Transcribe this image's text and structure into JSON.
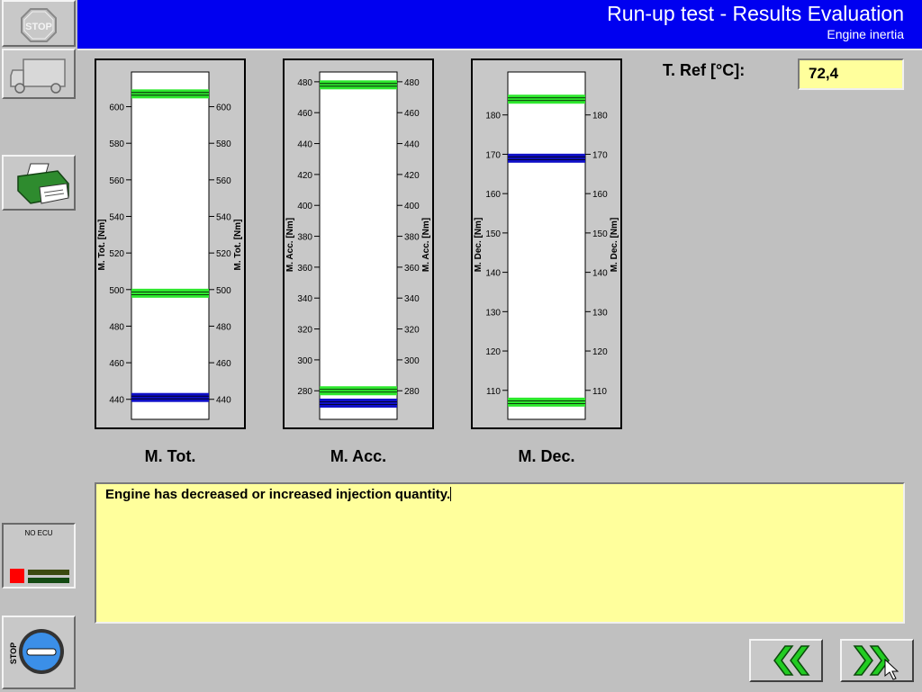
{
  "header": {
    "title": "Run-up test - Results Evaluation",
    "subtitle": "Engine inertia"
  },
  "sidebar": {
    "stop_button": {
      "label": "STOP",
      "icon": "stop-icon"
    },
    "vehicle_button": {
      "icon": "truck-icon"
    },
    "print_button": {
      "icon": "printer-icon"
    },
    "ecu_status": {
      "label": "NO ECU",
      "status_color": "#ff0000"
    },
    "stop_round_button": {
      "label": "STOP",
      "icon": "stop-round-icon"
    }
  },
  "t_ref": {
    "label": "T. Ref [°C]:",
    "value": "72,4"
  },
  "gauges": [
    {
      "name": "M. Tot.",
      "axis_label": "M. Tot. [Nm]",
      "min": 432,
      "max": 617,
      "ticks": [
        440,
        460,
        480,
        500,
        520,
        540,
        560,
        580,
        600
      ],
      "green": [
        607,
        498
      ],
      "blue": [
        441
      ]
    },
    {
      "name": "M. Acc.",
      "axis_label": "M. Acc. [Nm]",
      "min": 265,
      "max": 484,
      "ticks": [
        280,
        300,
        320,
        340,
        360,
        380,
        400,
        420,
        440,
        460,
        480
      ],
      "green": [
        478,
        280
      ],
      "blue": [
        272
      ]
    },
    {
      "name": "M. Dec.",
      "axis_label": "M. Dec. [Nm]",
      "min": 104,
      "max": 190,
      "ticks": [
        110,
        120,
        130,
        140,
        150,
        160,
        170,
        180
      ],
      "green": [
        184,
        107
      ],
      "blue": [
        169
      ]
    }
  ],
  "message": "Engine has decreased or increased injection quantity.",
  "navigation": {
    "back_icon": "double-chevron-left-icon",
    "forward_icon": "double-chevron-right-icon"
  },
  "colors": {
    "header_bg": "#0000f0",
    "green_line": "#2ee82e",
    "blue_line": "#1010c8",
    "input_bg": "#ffff9c"
  }
}
